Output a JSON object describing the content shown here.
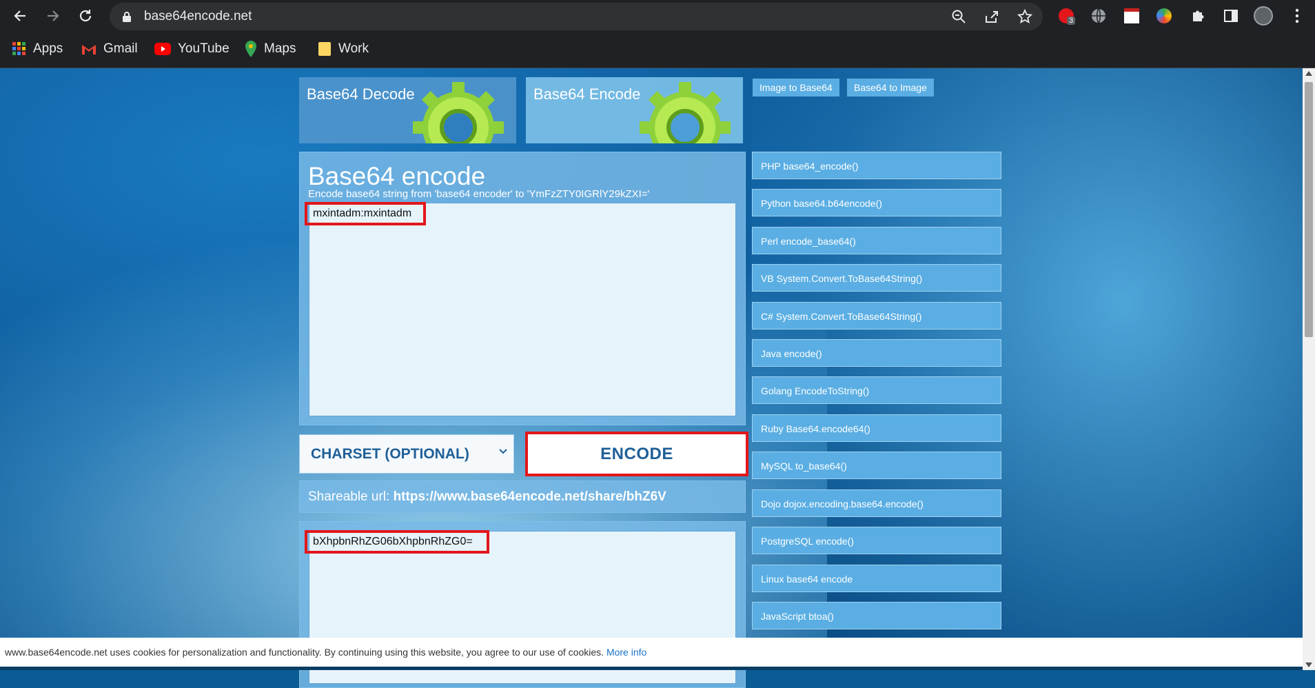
{
  "browser": {
    "url": "base64encode.net",
    "extension_badge": "3",
    "bookmarks": [
      "Apps",
      "Gmail",
      "YouTube",
      "Maps",
      "Work"
    ]
  },
  "tiles": {
    "decode": "Base64 Decode",
    "encode": "Base64 Encode"
  },
  "top_buttons": {
    "image_to_base64": "Image to Base64",
    "base64_to_image": "Base64 to Image"
  },
  "panel": {
    "title": "Base64 encode",
    "subtitle": "Encode base64 string from 'base64 encoder' to 'YmFzZTY0IGRlY29kZXI='",
    "input_value": "mxintadm:mxintadm"
  },
  "charset": {
    "label": "CHARSET (OPTIONAL)"
  },
  "encode_button": {
    "label": "ENCODE"
  },
  "share": {
    "label": "Shareable url:",
    "url": "https://www.base64encode.net/share/bhZ6V"
  },
  "output": {
    "value": "bXhpbnRhZG06bXhpbnRhZG0="
  },
  "side_links": [
    "PHP base64_encode()",
    "Python base64.b64encode()",
    "Perl encode_base64()",
    "VB System.Convert.ToBase64String()",
    "C# System.Convert.ToBase64String()",
    "Java encode()",
    "Golang EncodeToString()",
    "Ruby Base64.encode64()",
    "MySQL to_base64()",
    "Dojo dojox.encoding.base64.encode()",
    "PostgreSQL encode()",
    "Linux base64 encode",
    "JavaScript btoa()"
  ],
  "cookie": {
    "text": "www.base64encode.net uses cookies for personalization and functionality. By continuing using this website, you agree to our use of cookies.",
    "link": "More info"
  },
  "colors": {
    "accent": "#1e5f97",
    "highlight": "#e3161b",
    "chrome": "#202124"
  }
}
